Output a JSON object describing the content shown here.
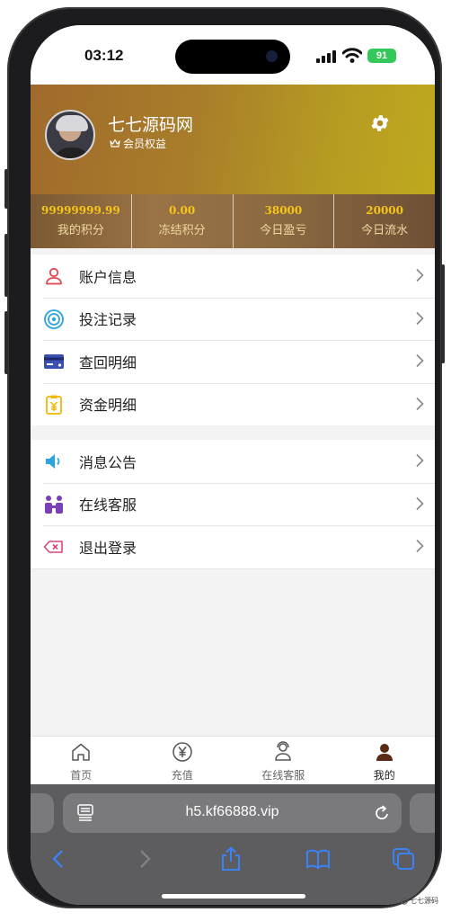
{
  "status_bar": {
    "time": "03:12",
    "battery": "91"
  },
  "profile": {
    "username": "七七源码网",
    "vip_label": "会员权益"
  },
  "stats": [
    {
      "value": "99999999.99",
      "label": "我的积分"
    },
    {
      "value": "0.00",
      "label": "冻结积分"
    },
    {
      "value": "38000",
      "label": "今日盈亏"
    },
    {
      "value": "20000",
      "label": "今日流水"
    }
  ],
  "menu_group_1": [
    {
      "label": "账户信息",
      "icon": "user-icon"
    },
    {
      "label": "投注记录",
      "icon": "target-icon"
    },
    {
      "label": "查回明细",
      "icon": "card-icon"
    },
    {
      "label": "资金明细",
      "icon": "yuan-clipboard-icon"
    }
  ],
  "menu_group_2": [
    {
      "label": "消息公告",
      "icon": "speaker-icon"
    },
    {
      "label": "在线客服",
      "icon": "people-icon"
    },
    {
      "label": "退出登录",
      "icon": "logout-icon"
    }
  ],
  "tabbar": [
    {
      "label": "首页",
      "icon": "home-icon"
    },
    {
      "label": "充值",
      "icon": "yuan-circle-icon"
    },
    {
      "label": "在线客服",
      "icon": "support-icon"
    },
    {
      "label": "我的",
      "icon": "profile-icon",
      "active": true
    }
  ],
  "browser": {
    "url": "h5.kf66888.vip"
  },
  "watermark": "七七源码",
  "colors": {
    "accent_gold": "#f5c518",
    "header_start": "#a06a2c",
    "header_end": "#bfa91e"
  }
}
